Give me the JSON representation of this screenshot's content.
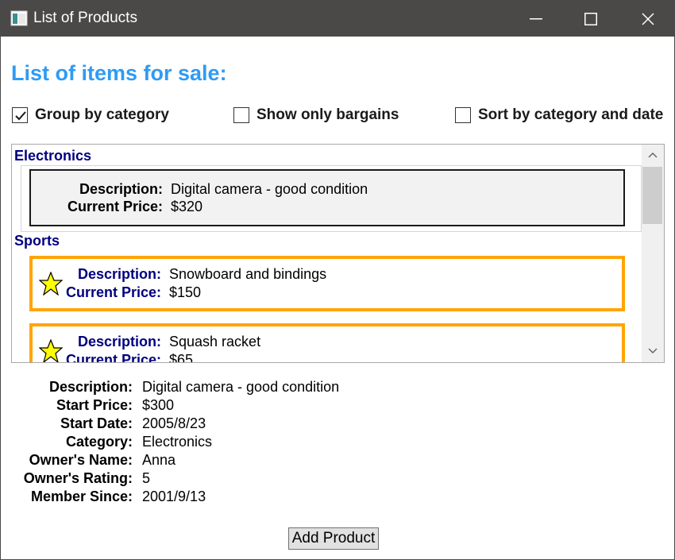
{
  "window": {
    "title": "List of Products",
    "icon": "app-window-icon",
    "controls": [
      "minimize-icon",
      "maximize-icon",
      "close-icon"
    ]
  },
  "heading": "List of items for sale:",
  "options": [
    {
      "label": "Group by category",
      "checked": true
    },
    {
      "label": "Show only bargains",
      "checked": false
    },
    {
      "label": "Sort by category and date",
      "checked": false
    }
  ],
  "list": {
    "groups": [
      {
        "category": "Electronics",
        "items": [
          {
            "description": "Digital camera - good condition",
            "price": "$320",
            "bargain": false,
            "selected": true
          }
        ]
      },
      {
        "category": "Sports",
        "items": [
          {
            "description": "Snowboard and bindings",
            "price": "$150",
            "bargain": true
          },
          {
            "description": "Squash racket",
            "price": "$65",
            "bargain": true
          }
        ]
      }
    ],
    "labels": {
      "description": "Description:",
      "price": "Current Price:"
    }
  },
  "details": [
    {
      "label": "Description:",
      "value": "Digital camera - good condition"
    },
    {
      "label": "Start Price:",
      "value": "$300"
    },
    {
      "label": "Start Date:",
      "value": "2005/8/23"
    },
    {
      "label": "Category:",
      "value": "Electronics"
    },
    {
      "label": "Owner's Name:",
      "value": "Anna"
    },
    {
      "label": "Owner's Rating:",
      "value": "5"
    },
    {
      "label": "Member Since:",
      "value": "2001/9/13"
    }
  ],
  "add_button": "Add Product",
  "colors": {
    "heading": "#2f9bf4",
    "group_header": "#000080",
    "bargain_border": "#ffa500",
    "star_fill": "#ffff00",
    "titlebar": "#4a4948"
  }
}
